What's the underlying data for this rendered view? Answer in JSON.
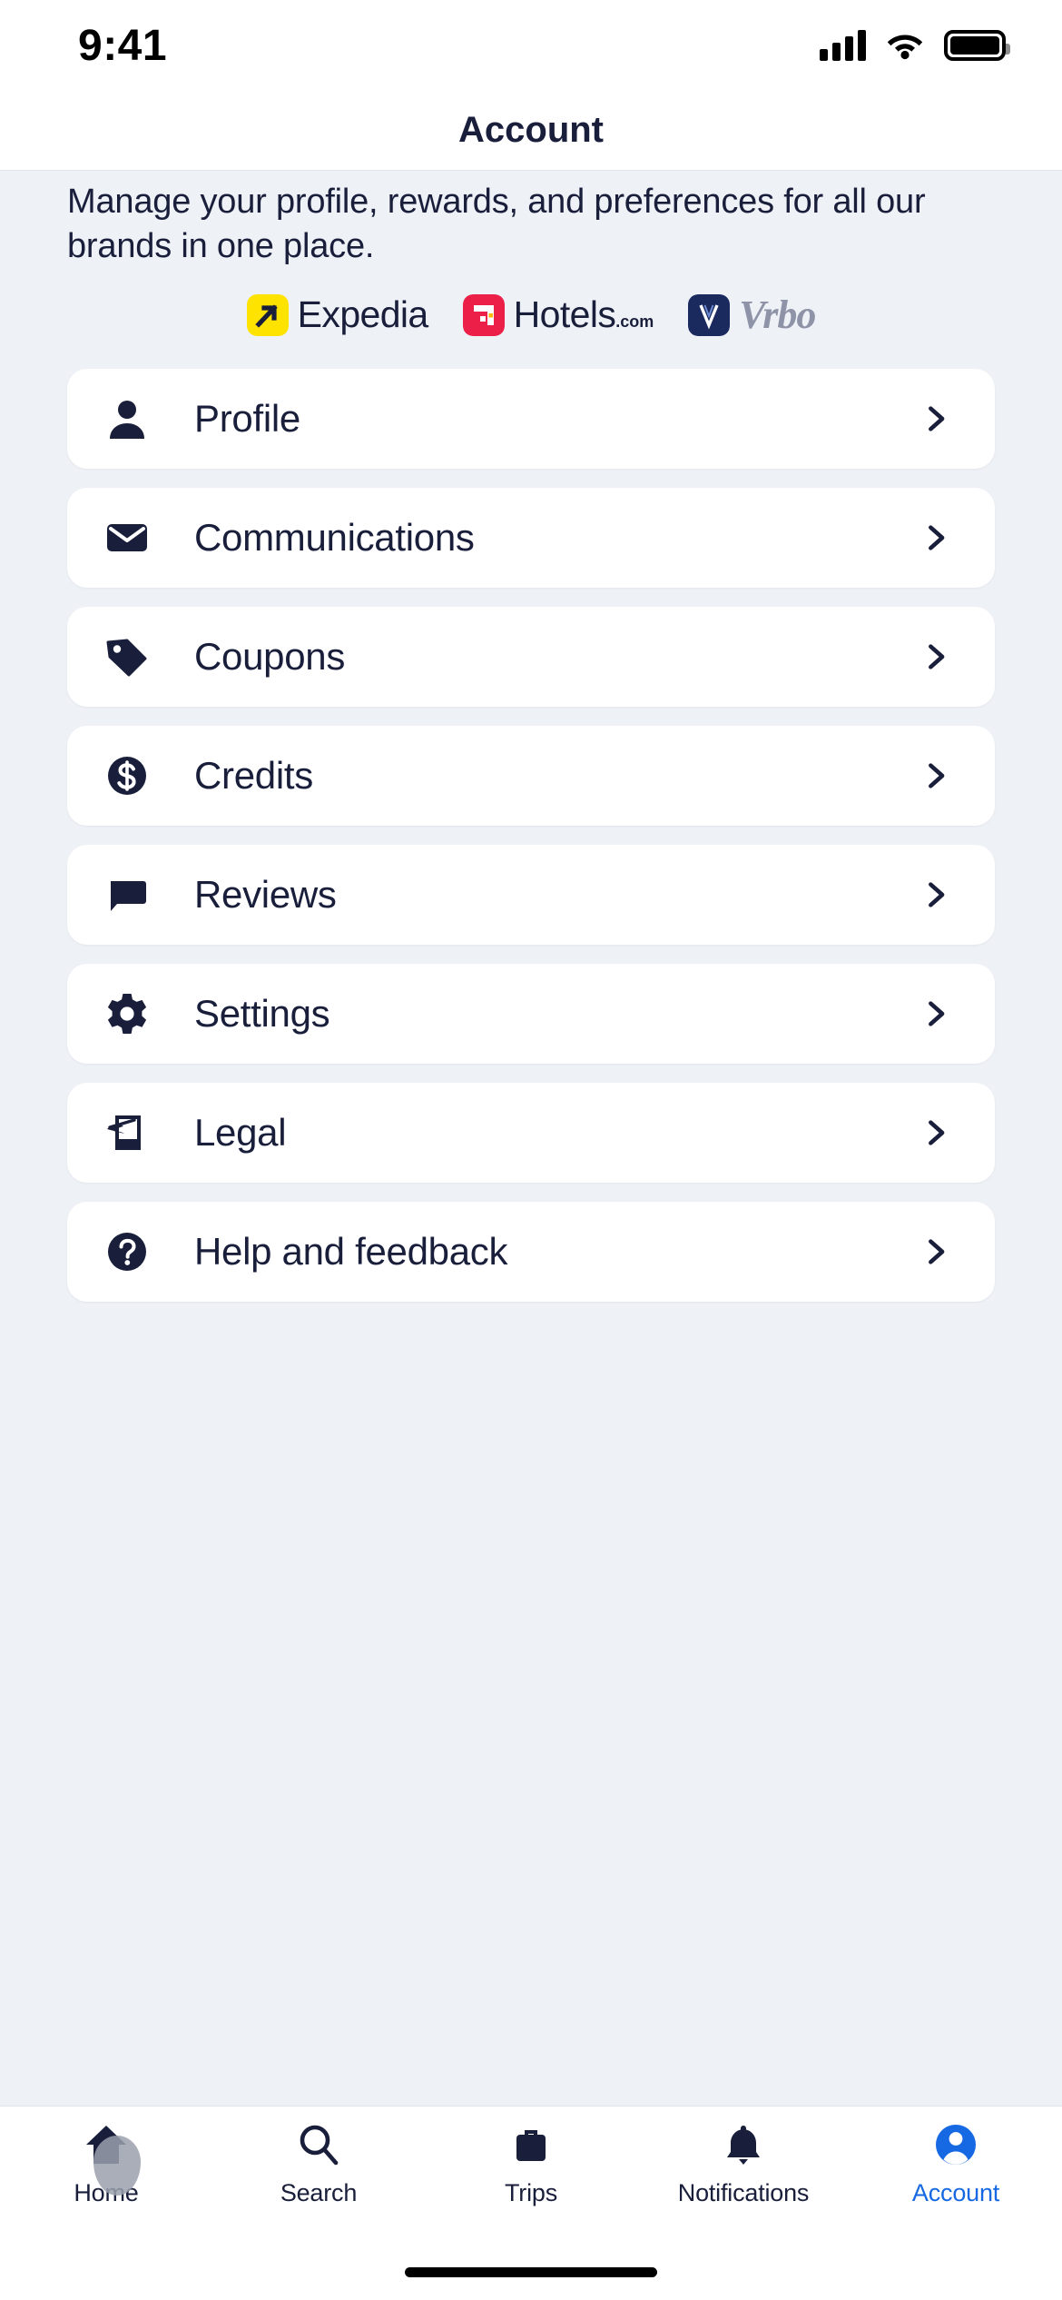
{
  "status_bar": {
    "time": "9:41",
    "signal_icon": "cellular-signal-icon",
    "wifi_icon": "wifi-icon",
    "battery_icon": "battery-full-icon"
  },
  "header": {
    "title": "Account"
  },
  "intro": {
    "subtitle": "Manage your profile, rewards, and preferences for all our brands in one place."
  },
  "brands": [
    {
      "name": "Expedia",
      "tld": "",
      "mark_bg": "#FFE300",
      "mark_fg": "#191E3B",
      "icon": "expedia-logo-icon"
    },
    {
      "name": "Hotels",
      "tld": ".com",
      "mark_bg": "#EB1F48",
      "mark_fg": "#FFFFFF",
      "icon": "hotels-logo-icon"
    },
    {
      "name": "Vrbo",
      "tld": "",
      "mark_bg": "#1B2A5E",
      "mark_fg": "#FFFFFF",
      "icon": "vrbo-logo-icon"
    }
  ],
  "menu": {
    "items": [
      {
        "label": "Profile",
        "icon": "person-icon"
      },
      {
        "label": "Communications",
        "icon": "envelope-icon"
      },
      {
        "label": "Coupons",
        "icon": "tag-icon"
      },
      {
        "label": "Credits",
        "icon": "dollar-circle-icon"
      },
      {
        "label": "Reviews",
        "icon": "speech-bubble-icon"
      },
      {
        "label": "Settings",
        "icon": "gear-icon"
      },
      {
        "label": "Legal",
        "icon": "document-pen-icon"
      },
      {
        "label": "Help and feedback",
        "icon": "question-circle-icon"
      }
    ],
    "chevron_icon": "chevron-right-icon"
  },
  "tab_bar": {
    "active": "Account",
    "tabs": [
      {
        "label": "Home",
        "icon": "home-icon"
      },
      {
        "label": "Search",
        "icon": "search-icon"
      },
      {
        "label": "Trips",
        "icon": "suitcase-icon"
      },
      {
        "label": "Notifications",
        "icon": "bell-icon"
      },
      {
        "label": "Account",
        "icon": "account-avatar-icon"
      }
    ]
  },
  "colors": {
    "ink": "#191E3B",
    "accent": "#1668E3",
    "page_bg": "#EEF1F6",
    "card_bg": "#FFFFFF"
  }
}
